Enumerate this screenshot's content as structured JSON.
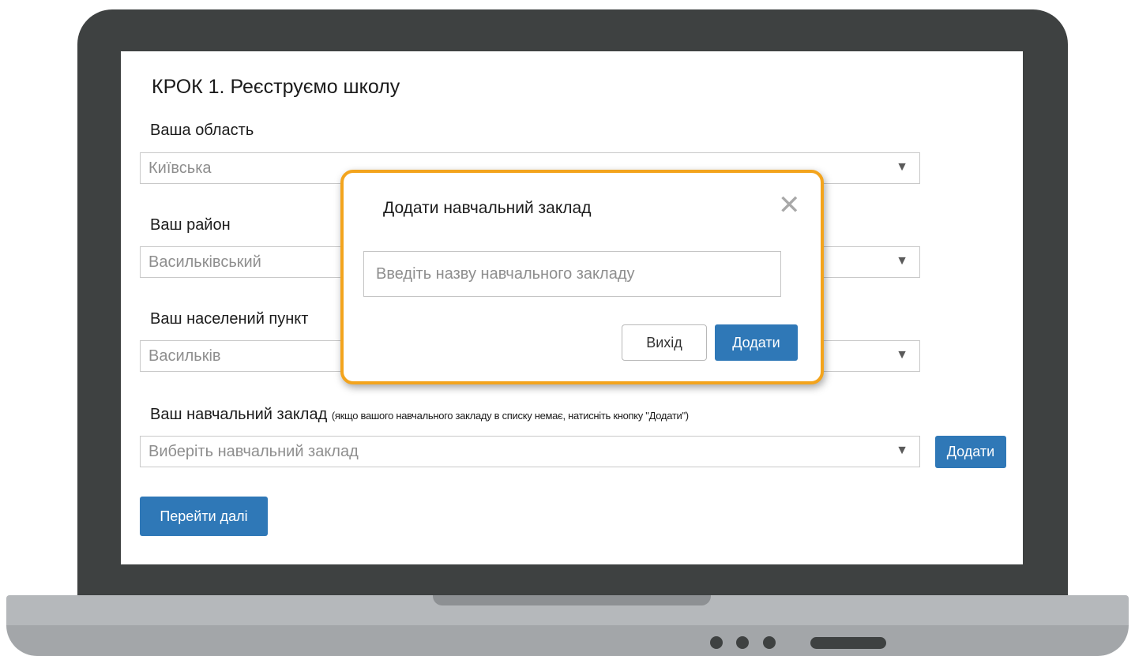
{
  "page": {
    "title": "КРОК 1. Реєструємо школу"
  },
  "fields": [
    {
      "label": "Ваша область",
      "value": "Київська"
    },
    {
      "label": "Ваш район",
      "value": "Васильківський"
    },
    {
      "label": "Ваш населений пункт",
      "value": "Васильків"
    },
    {
      "label": "Ваш навчальний заклад",
      "hint": "(якщо вашого навчального закладу в списку немає, натисніть кнопку \"Додати\")",
      "placeholder": "Виберіть навчальний заклад"
    }
  ],
  "arrow_glyph": "▼",
  "buttons": {
    "add_side": "Додати",
    "next": "Перейти далі"
  },
  "modal": {
    "title": "Додати навчальний заклад",
    "close_glyph": "✕",
    "input_placeholder": "Введіть назву навчального закладу",
    "exit_label": "Вихід",
    "add_label": "Додати"
  },
  "colors": {
    "accent": "#2f78b7",
    "modal_border": "#f3a41d",
    "laptop_frame": "#3e4141"
  }
}
